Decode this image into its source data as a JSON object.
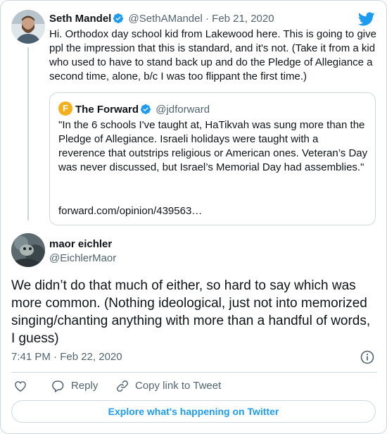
{
  "parent_tweet": {
    "name": "Seth Mandel",
    "handle": "@SethAMandel",
    "separator": "·",
    "date": "Feb 21, 2020",
    "text": "Hi. Orthodox day school kid from Lakewood here. This is going to give ppl the impression that this is standard, and it's not. (Take it from a kid who used to have to stand back up and do the Pledge of Allegiance a second time, alone, b/c I was too flippant the first time.)"
  },
  "quoted_tweet": {
    "name": "The Forward",
    "handle": "@jdforward",
    "logo_letter": "F",
    "text": "\"In the 6 schools I've taught at, HaTikvah was sung more than the Pledge of Allegiance. Israeli holidays were taught with a reverence that outstrips religious or American ones. Veteran’s Day was never discussed, but Israel’s Memorial Day had assemblies.\"",
    "link": "forward.com/opinion/439563…"
  },
  "main_tweet": {
    "name": "maor eichler",
    "handle": "@EichlerMaor",
    "text": "We didn’t do that much of either, so hard to say which was more common. (Nothing ideological, just not into memorized singing/chanting anything with more than a handful of words, I guess)",
    "timestamp": "7:41 PM · Feb 22, 2020"
  },
  "actions": {
    "reply_label": "Reply",
    "copy_label": "Copy link to Tweet"
  },
  "explore_label": "Explore what's happening on Twitter",
  "colors": {
    "accent": "#1d9bf0",
    "muted": "#536471",
    "border": "#cfd9de",
    "forward_logo": "#f3b01b"
  },
  "icons": {
    "brand": "twitter-bird-icon",
    "verified": "verified-badge-icon",
    "like": "heart-icon",
    "reply": "speech-bubble-icon",
    "copy": "link-icon",
    "info": "info-icon"
  }
}
